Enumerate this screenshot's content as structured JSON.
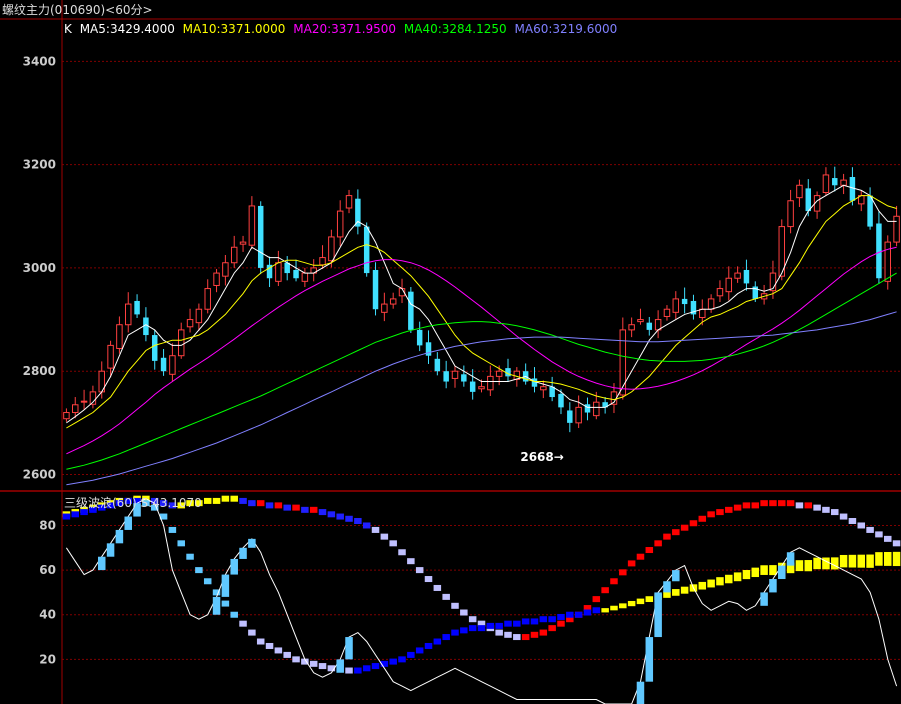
{
  "window": {
    "title": "螺纹主力(010690)<60分>"
  },
  "main_panel": {
    "indicator_name": "K",
    "ma_legend": [
      {
        "label": "MA5:3429.4000",
        "color": "#ffffff"
      },
      {
        "label": "MA10:3371.0000",
        "color": "#ffff00"
      },
      {
        "label": "MA20:3371.9500",
        "color": "#ff00ff"
      },
      {
        "label": "MA40:3284.1250",
        "color": "#00ff00"
      },
      {
        "label": "MA60:3219.6000",
        "color": "#8080ff"
      }
    ],
    "min_annotation": "2668"
  },
  "sub_panel": {
    "legend": "三级波浪(60) S:43.1070"
  },
  "colors": {
    "up": "#ff4040",
    "down": "#40e0ff",
    "grid": "#800000",
    "frame": "#a00000"
  },
  "chart_data": [
    {
      "type": "candlestick",
      "ylim": [
        2570,
        3480
      ],
      "yticks": [
        2600,
        2800,
        3000,
        3200,
        3400
      ],
      "grid": true,
      "close": [
        2720,
        2735,
        2742,
        2760,
        2800,
        2850,
        2890,
        2930,
        2910,
        2870,
        2820,
        2800,
        2830,
        2880,
        2900,
        2920,
        2960,
        2990,
        3010,
        3040,
        3050,
        3120,
        3000,
        2980,
        3010,
        2990,
        2980,
        2990,
        3000,
        3020,
        3060,
        3110,
        3140,
        3080,
        2990,
        2920,
        2930,
        2940,
        2960,
        2880,
        2850,
        2830,
        2800,
        2780,
        2800,
        2780,
        2760,
        2770,
        2790,
        2800,
        2790,
        2800,
        2780,
        2770,
        2770,
        2750,
        2730,
        2700,
        2730,
        2720,
        2740,
        2730,
        2760,
        2880,
        2890,
        2900,
        2880,
        2900,
        2920,
        2940,
        2930,
        2910,
        2920,
        2940,
        2960,
        2980,
        2990,
        2970,
        2940,
        2950,
        2990,
        3080,
        3130,
        3160,
        3110,
        3140,
        3180,
        3160,
        3170,
        3130,
        3140,
        3080,
        2980,
        3050,
        3100
      ],
      "ma5": [
        2700,
        2712,
        2725,
        2740,
        2760,
        2790,
        2830,
        2870,
        2880,
        2890,
        2880,
        2860,
        2850,
        2850,
        2860,
        2880,
        2900,
        2930,
        2960,
        2990,
        3010,
        3040,
        3030,
        3020,
        3020,
        3010,
        3000,
        2990,
        2990,
        3000,
        3010,
        3040,
        3070,
        3090,
        3080,
        3050,
        3010,
        2970,
        2960,
        2930,
        2920,
        2900,
        2870,
        2840,
        2810,
        2800,
        2790,
        2780,
        2780,
        2780,
        2780,
        2785,
        2790,
        2780,
        2775,
        2770,
        2760,
        2745,
        2740,
        2730,
        2730,
        2730,
        2740,
        2770,
        2800,
        2830,
        2860,
        2880,
        2890,
        2900,
        2910,
        2915,
        2920,
        2920,
        2925,
        2935,
        2950,
        2960,
        2960,
        2955,
        2960,
        2990,
        3030,
        3080,
        3110,
        3130,
        3140,
        3150,
        3160,
        3155,
        3150,
        3140,
        3110,
        3090,
        3090
      ],
      "ma10": [
        2690,
        2700,
        2710,
        2720,
        2735,
        2750,
        2775,
        2800,
        2820,
        2840,
        2850,
        2855,
        2860,
        2860,
        2865,
        2870,
        2880,
        2895,
        2910,
        2930,
        2950,
        2975,
        2990,
        3000,
        3010,
        3015,
        3015,
        3010,
        3005,
        3005,
        3010,
        3020,
        3030,
        3040,
        3045,
        3040,
        3030,
        3015,
        3000,
        2985,
        2965,
        2945,
        2920,
        2895,
        2870,
        2850,
        2835,
        2825,
        2815,
        2805,
        2795,
        2790,
        2785,
        2780,
        2780,
        2778,
        2775,
        2770,
        2765,
        2758,
        2752,
        2748,
        2745,
        2750,
        2760,
        2775,
        2790,
        2810,
        2830,
        2850,
        2865,
        2880,
        2895,
        2905,
        2910,
        2918,
        2925,
        2935,
        2940,
        2945,
        2950,
        2960,
        2985,
        3010,
        3040,
        3065,
        3090,
        3105,
        3120,
        3130,
        3140,
        3140,
        3130,
        3120,
        3115
      ],
      "ma20": [
        2640,
        2648,
        2656,
        2665,
        2675,
        2686,
        2698,
        2712,
        2726,
        2740,
        2755,
        2768,
        2780,
        2792,
        2804,
        2815,
        2826,
        2838,
        2850,
        2862,
        2875,
        2888,
        2900,
        2912,
        2924,
        2935,
        2946,
        2956,
        2965,
        2974,
        2982,
        2990,
        2998,
        3004,
        3010,
        3014,
        3016,
        3016,
        3014,
        3010,
        3004,
        2996,
        2986,
        2975,
        2963,
        2950,
        2937,
        2924,
        2910,
        2896,
        2882,
        2868,
        2855,
        2842,
        2830,
        2818,
        2808,
        2798,
        2790,
        2783,
        2777,
        2772,
        2768,
        2766,
        2765,
        2766,
        2768,
        2771,
        2775,
        2780,
        2786,
        2793,
        2801,
        2810,
        2820,
        2830,
        2841,
        2852,
        2862,
        2872,
        2882,
        2893,
        2905,
        2918,
        2932,
        2946,
        2960,
        2974,
        2988,
        3000,
        3012,
        3022,
        3030,
        3036,
        3040
      ],
      "ma40": [
        2610,
        2614,
        2618,
        2623,
        2628,
        2634,
        2640,
        2647,
        2654,
        2661,
        2668,
        2675,
        2682,
        2689,
        2696,
        2703,
        2710,
        2717,
        2724,
        2731,
        2738,
        2745,
        2752,
        2760,
        2768,
        2776,
        2784,
        2792,
        2800,
        2808,
        2816,
        2824,
        2832,
        2840,
        2848,
        2856,
        2862,
        2868,
        2874,
        2879,
        2883,
        2887,
        2890,
        2892,
        2894,
        2895,
        2896,
        2896,
        2895,
        2893,
        2891,
        2888,
        2884,
        2880,
        2875,
        2870,
        2864,
        2858,
        2852,
        2847,
        2842,
        2837,
        2833,
        2829,
        2826,
        2823,
        2821,
        2820,
        2819,
        2819,
        2819,
        2820,
        2821,
        2823,
        2826,
        2829,
        2833,
        2838,
        2843,
        2849,
        2856,
        2864,
        2872,
        2881,
        2890,
        2900,
        2910,
        2920,
        2930,
        2940,
        2950,
        2960,
        2970,
        2980,
        2990
      ],
      "ma60": [
        2580,
        2583,
        2586,
        2589,
        2593,
        2597,
        2601,
        2606,
        2611,
        2616,
        2621,
        2626,
        2631,
        2637,
        2643,
        2649,
        2655,
        2661,
        2668,
        2675,
        2682,
        2689,
        2696,
        2704,
        2712,
        2720,
        2728,
        2736,
        2744,
        2752,
        2760,
        2768,
        2776,
        2784,
        2792,
        2800,
        2807,
        2814,
        2820,
        2826,
        2831,
        2836,
        2840,
        2844,
        2848,
        2851,
        2854,
        2857,
        2859,
        2861,
        2863,
        2864,
        2865,
        2866,
        2866,
        2866,
        2866,
        2865,
        2864,
        2863,
        2862,
        2861,
        2860,
        2859,
        2858,
        2857,
        2857,
        2857,
        2858,
        2859,
        2860,
        2861,
        2862,
        2863,
        2864,
        2865,
        2866,
        2867,
        2868,
        2869,
        2870,
        2872,
        2874,
        2876,
        2878,
        2880,
        2883,
        2886,
        2889,
        2892,
        2896,
        2900,
        2905,
        2910,
        2915
      ]
    },
    {
      "type": "line",
      "title": "三级波浪(60)",
      "ylim": [
        0,
        95
      ],
      "yticks": [
        20,
        40,
        60,
        80
      ],
      "grid": true,
      "series": [
        {
          "name": "S",
          "color": "#ffffff",
          "values": [
            70,
            64,
            58,
            60,
            66,
            72,
            78,
            84,
            90,
            92,
            90,
            80,
            60,
            50,
            40,
            38,
            40,
            48,
            58,
            65,
            70,
            74,
            68,
            58,
            50,
            40,
            30,
            20,
            14,
            12,
            14,
            20,
            30,
            32,
            28,
            22,
            16,
            10,
            8,
            6,
            8,
            10,
            12,
            14,
            16,
            14,
            12,
            10,
            8,
            6,
            4,
            2,
            2,
            2,
            2,
            2,
            2,
            2,
            2,
            2,
            2,
            0,
            0,
            0,
            0,
            10,
            30,
            50,
            55,
            60,
            62,
            52,
            45,
            42,
            44,
            46,
            45,
            42,
            44,
            50,
            56,
            62,
            68,
            70,
            68,
            66,
            64,
            62,
            60,
            58,
            56,
            50,
            38,
            20,
            8
          ]
        },
        {
          "name": "wave-hi",
          "values": [
            85,
            86,
            87,
            88,
            89,
            90,
            91,
            91,
            92,
            92,
            91,
            90,
            89,
            89,
            90,
            90,
            91,
            91,
            92,
            92,
            91,
            90,
            90,
            89,
            89,
            88,
            88,
            87,
            87,
            86,
            85,
            84,
            83,
            82,
            80,
            78,
            75,
            72,
            68,
            64,
            60,
            56,
            52,
            48,
            44,
            41,
            38,
            36,
            34,
            32,
            31,
            30,
            30,
            31,
            32,
            34,
            36,
            38,
            40,
            43,
            47,
            51,
            55,
            59,
            63,
            66,
            69,
            72,
            75,
            77,
            79,
            81,
            83,
            85,
            86,
            87,
            88,
            89,
            89,
            90,
            90,
            90,
            90,
            89,
            89,
            88,
            87,
            86,
            84,
            82,
            80,
            78,
            76,
            74,
            72
          ]
        },
        {
          "name": "wave-lo",
          "values": [
            84,
            85,
            86,
            87,
            88,
            89,
            90,
            91,
            91,
            90,
            88,
            84,
            78,
            72,
            66,
            60,
            55,
            50,
            45,
            40,
            36,
            32,
            28,
            26,
            24,
            22,
            20,
            19,
            18,
            17,
            16,
            16,
            15,
            15,
            16,
            17,
            18,
            19,
            20,
            22,
            24,
            26,
            28,
            30,
            32,
            33,
            34,
            34,
            35,
            35,
            36,
            36,
            37,
            37,
            38,
            38,
            39,
            40,
            40,
            41,
            42,
            42,
            43,
            44,
            45,
            46,
            47,
            48,
            49,
            50,
            51,
            52,
            53,
            54,
            55,
            56,
            57,
            58,
            59,
            60,
            60,
            61,
            61,
            62,
            62,
            63,
            63,
            63,
            64,
            64,
            64,
            64,
            65,
            65,
            65
          ]
        }
      ]
    }
  ]
}
